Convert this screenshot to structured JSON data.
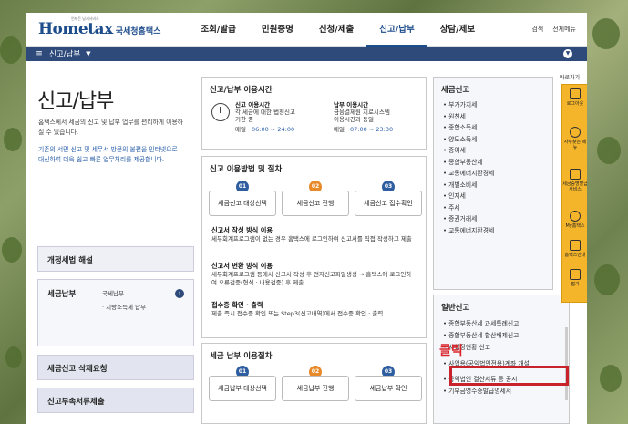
{
  "header": {
    "logo_main": "Hometax",
    "logo_sub": "국세청홈택스",
    "logo_tag": "언제든 납세서비스",
    "nav": [
      "조회/발급",
      "민원증명",
      "신청/제출",
      "신고/납부",
      "상담/제보"
    ],
    "search_label": "검색",
    "menu_label": "전체메뉴"
  },
  "crumbbar": {
    "label": "신고/납부"
  },
  "left": {
    "title": "신고/납부",
    "desc1": "홈택스에서 세금의 신고 및 납부 업무를 편리하게 이용하실 수 있습니다.",
    "desc2": "기존의 서면 신고 및 세무서 방문의 불편을 인터넷으로 대신하여 더욱 쉽고 빠른 업무처리를 제공합니다.",
    "box1": "개정세법 해설",
    "box2_title": "세금납부",
    "box2_sub1": "국세납부",
    "box2_sub2": "· 지방소득세 납부",
    "box3": "세금신고 삭제요청",
    "box4": "신고부속서류제출"
  },
  "hours": {
    "title": "신고/납부 이용시간",
    "left_head": "신고 이용시간",
    "left_line1": "각 세금에 대한 법정신고",
    "left_line2": "기한 중",
    "left_time_label": "매일",
    "left_time": "06:00 ~ 24:00",
    "right_head": "납부 이용시간",
    "right_line1": "금융결제원 지로시스템",
    "right_line2": "이용시간과 동일",
    "right_time_label": "매일",
    "right_time": "07:00 ~ 23:30"
  },
  "procedure": {
    "title": "신고 이용방법 및 절차",
    "steps": [
      {
        "num": "01",
        "label": "세금신고 대상선택"
      },
      {
        "num": "02",
        "label": "세금신고 진행"
      },
      {
        "num": "03",
        "label": "세금신고 접수확인"
      }
    ],
    "item1_title": "신고서 작성 방식 이용",
    "item1_text": "세무회계프로그램이 없는 경우 홈택스에 로그인하여 신고서를 직접 작성하고 제출",
    "item2_title": "신고서 변환 방식 이용",
    "item2_text": "세무회계프로그램 등에서 신고서 작성 후 전자신고파일생성 → 홈택스에 로그인하여 오류검증(형식 · 내용검증) 후 제출",
    "item3_title": "접수증 확인 · 출력",
    "item3_text": "제출 즉시 접수증 확인 또는 Step3(신고내역)에서 접수증 확인 · 출력"
  },
  "payment": {
    "title": "세금 납부 이용절차",
    "steps": [
      {
        "num": "01",
        "label": "세금납부 대상선택"
      },
      {
        "num": "02",
        "label": "세금납부 진행"
      },
      {
        "num": "03",
        "label": "세금납부 확인"
      }
    ]
  },
  "tax_report": {
    "title": "세금신고",
    "items": [
      "부가가치세",
      "원천세",
      "종합소득세",
      "양도소득세",
      "증여세",
      "종합부동산세",
      "교통에너지환경세",
      "개별소비세",
      "인지세",
      "주세",
      "증권거래세",
      "교통에너지환경세"
    ]
  },
  "general": {
    "title": "일반신고",
    "items": [
      "종합부동산세 과세특례신고",
      "종합부동산세 합산배제신고",
      "사업장현황 신고",
      "사업용(공익법인전용)계좌 개설",
      "공익법인 결산서류 등 공시",
      "기부금영수증발급명세서"
    ]
  },
  "quick": {
    "head": "바로가기",
    "items": [
      "로그아웃",
      "자주찾는 메뉴",
      "세금증명발급 서비스",
      "My홈택스",
      "홈택스안내",
      "접기"
    ]
  },
  "callout": "클릭"
}
